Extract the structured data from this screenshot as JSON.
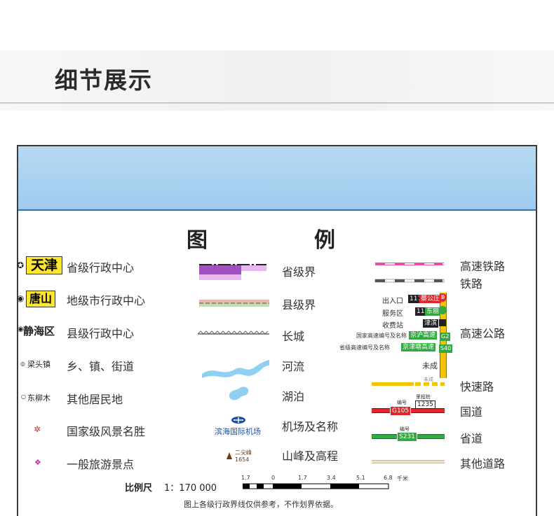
{
  "header": {
    "title": "细节展示"
  },
  "legend": {
    "title_left": "图",
    "title_right": "例",
    "left": [
      {
        "sample": "天津",
        "label": "省级行政中心"
      },
      {
        "sample": "唐山",
        "label": "地级市行政中心"
      },
      {
        "sample": "静海区",
        "label": "县级行政中心"
      },
      {
        "sample": "梁头镇",
        "label": "乡、镇、街道"
      },
      {
        "sample": "东柳木",
        "label": "其他居民地"
      },
      {
        "sample": "",
        "label": "国家级风景名胜"
      },
      {
        "sample": "",
        "label": "一般旅游景点"
      }
    ],
    "middle": [
      {
        "label": "省级界"
      },
      {
        "label": "县级界"
      },
      {
        "label": "长城"
      },
      {
        "label": "河流"
      },
      {
        "label": "湖泊"
      },
      {
        "sample": "滨海国际机场",
        "label": "机场及名称"
      },
      {
        "sample_name": "二尖峰",
        "sample_elev": "1654",
        "label": "山峰及高程"
      }
    ],
    "right": {
      "rail_high": "高速铁路",
      "rail": "铁路",
      "expressway": "高速公路",
      "exit_label": "出入口",
      "exit_num": "117",
      "exit_name": "蔡公庄",
      "service_label": "服务区",
      "service_num": "115",
      "service_name": "东丽",
      "toll_label": "收费站",
      "toll_name": "津滨",
      "nat_code_label": "国家高速编号及名称",
      "nat_name": "京沪高速",
      "nat_code": "G2",
      "prov_code_label": "省级高速编号及名称",
      "prov_name": "京津塘高速",
      "prov_code": "S40",
      "unbuilt": "未成",
      "fast_road": "快速路",
      "national_road": "国道",
      "national_bianhao": "编号",
      "national_licheng": "里程桩",
      "national_code": "G105",
      "national_km": "1235",
      "prov_road": "省道",
      "prov_bianhao": "编号",
      "prov_road_code": "S231",
      "other_road": "其他道路"
    }
  },
  "scale": {
    "label": "比例尺",
    "ratio": "1：170 000",
    "ticks": [
      "1.7",
      "0",
      "1.7",
      "3.4",
      "5.1",
      "6.8"
    ],
    "unit": "千米"
  },
  "footnote": "图上各级行政界线仅供参考，不作划界依据。",
  "colors": {
    "sky": "#a9d2f1",
    "province_border": "#a24fc0",
    "expressway": "#f5c400",
    "national_road": "#e0272c",
    "provincial_road": "#33a843"
  }
}
